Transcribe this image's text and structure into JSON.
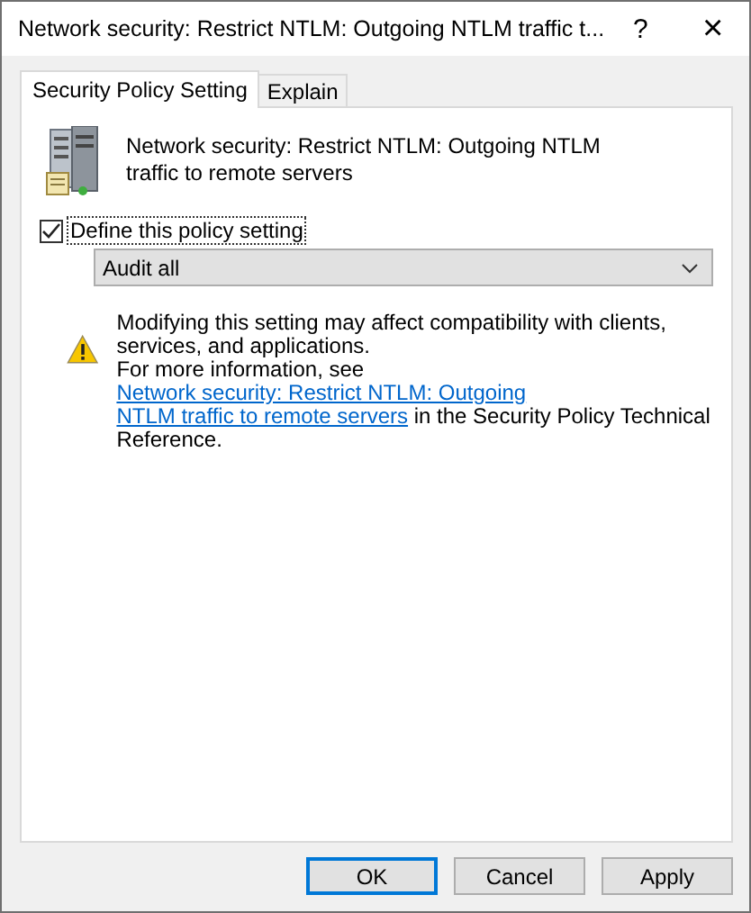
{
  "window": {
    "title": "Network security: Restrict NTLM: Outgoing NTLM traffic t...",
    "help": "?",
    "close": "×"
  },
  "tabs": [
    {
      "label": "Security Policy Setting",
      "selected": true
    },
    {
      "label": "Explain",
      "selected": false
    }
  ],
  "policy": {
    "name": "Network security: Restrict NTLM: Outgoing NTLM traffic to remote servers"
  },
  "define": {
    "label": "Define this policy setting",
    "checked": true
  },
  "dropdown": {
    "value": "Audit all"
  },
  "warning": {
    "text": "Modifying this setting may affect compatibility with clients, services, and applications.",
    "before": "For more information, see ",
    "link": [
      "Network security: Restrict NTLM: Outgoing",
      "NTLM traffic to remote servers"
    ],
    "after": " in the Security Policy Technical Reference."
  },
  "buttons": [
    {
      "label": "OK",
      "default": true
    },
    {
      "label": "Cancel",
      "default": false
    },
    {
      "label": "Apply",
      "default": false
    }
  ]
}
